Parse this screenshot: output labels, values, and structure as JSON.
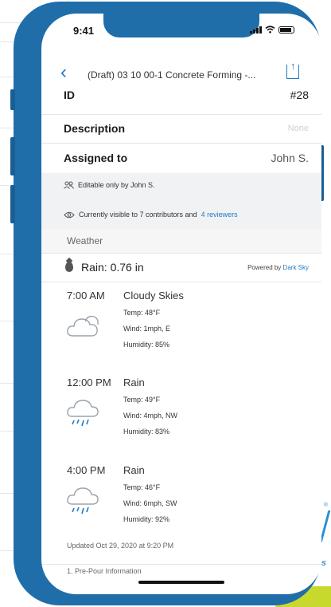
{
  "status_bar": {
    "time": "9:41"
  },
  "nav": {
    "title": "(Draft) 03 10 00-1 Concrete Forming -...",
    "back_glyph": "‹"
  },
  "fields": {
    "id": {
      "label": "ID",
      "value": "#28"
    },
    "description": {
      "label": "Description",
      "value": "None"
    },
    "assigned": {
      "label": "Assigned to",
      "value": "John S."
    }
  },
  "visibility": {
    "editable": "Editable only by John S.",
    "visible_prefix": "Currently visible to 7 contributors and",
    "reviewers_link": "4 reviewers"
  },
  "weather": {
    "section_title": "Weather",
    "rain": "Rain: 0.76 in",
    "powered_prefix": "Powered by",
    "powered_link": "Dark Sky",
    "forecasts": [
      {
        "time": "7:00 AM",
        "condition": "Cloudy Skies",
        "temp": "Temp: 48°F",
        "wind": "Wind: 1mph, E",
        "humidity": "Humidity: 85%",
        "icon": "cloud-icon"
      },
      {
        "time": "12:00 PM",
        "condition": "Rain",
        "temp": "Temp: 49°F",
        "wind": "Wind: 4mph, NW",
        "humidity": "Humidity: 83%",
        "icon": "rain-cloud-icon"
      },
      {
        "time": "4:00 PM",
        "condition": "Rain",
        "temp": "Temp: 46°F",
        "wind": "Wind: 6mph, SW",
        "humidity": "Humidity: 92%",
        "icon": "rain-cloud-icon"
      }
    ],
    "updated": "Updated Oct 29, 2020 at 9:20 PM",
    "next_section_partial": "1. Pre-Pour Information"
  },
  "colors": {
    "frame": "#1f6eaa",
    "accent": "#1f7bc4",
    "lime": "#c8d92e"
  }
}
